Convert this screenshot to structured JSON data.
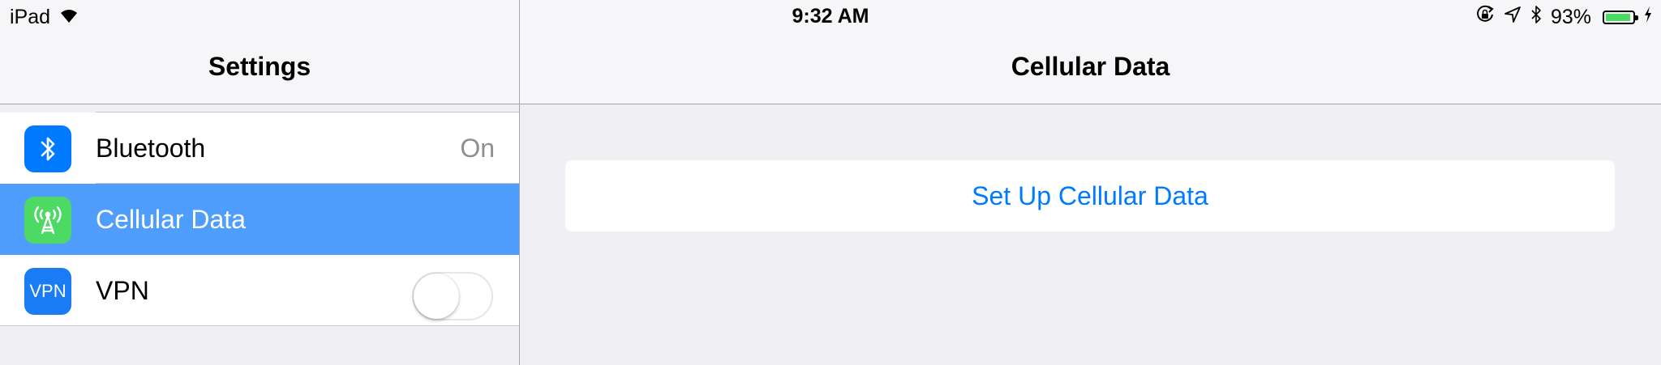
{
  "status_bar": {
    "device": "iPad",
    "time": "9:32 AM",
    "battery_percent": "93%",
    "battery_level": 0.93,
    "icons": [
      "wifi-icon",
      "rotation-lock-icon",
      "location-icon",
      "bluetooth-icon",
      "battery-icon",
      "charging-icon"
    ]
  },
  "master": {
    "title": "Settings",
    "items": [
      {
        "label": "Bluetooth",
        "value": "On",
        "icon": "bluetooth-icon",
        "icon_color": "#007aff"
      },
      {
        "label": "Cellular Data",
        "icon": "cellular-antenna-icon",
        "icon_color": "#4cd964",
        "selected": true
      },
      {
        "label": "VPN",
        "icon_text": "VPN",
        "icon_color": "#1a7cf4",
        "toggle_on": false
      }
    ]
  },
  "detail": {
    "title": "Cellular Data",
    "setup_button": "Set Up Cellular Data"
  },
  "colors": {
    "selection": "#4f9efe",
    "tint": "#007aff",
    "background": "#efeff4"
  }
}
